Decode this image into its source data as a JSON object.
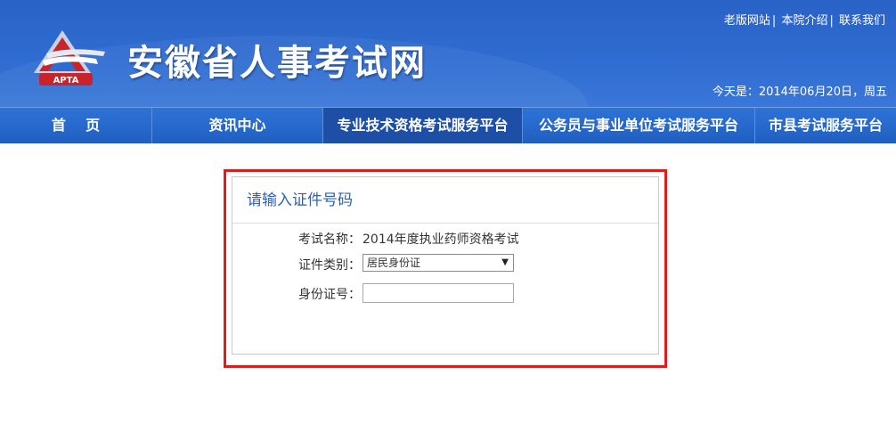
{
  "header": {
    "site_title": "安徽省人事考试网",
    "logo_text": "APTA",
    "top_links": [
      "老版网站",
      "本院介绍",
      "联系我们"
    ],
    "date_text": "今天是：2014年06月20日，周五"
  },
  "nav": {
    "items": [
      {
        "label": "首    页"
      },
      {
        "label": "资讯中心"
      },
      {
        "label": "专业技术资格考试服务平台"
      },
      {
        "label": "公务员与事业单位考试服务平台"
      },
      {
        "label": "市县考试服务平台"
      }
    ],
    "active_index": 2
  },
  "form": {
    "title": "请输入证件号码",
    "exam_name_label": "考试名称：",
    "exam_name_value": "2014年度执业药师资格考试",
    "id_type_label": "证件类别：",
    "id_type_value": "居民身份证",
    "id_number_label": "身份证号：",
    "id_number_value": "",
    "id_number_placeholder": ""
  },
  "colors": {
    "header_blue": "#2f6cd1",
    "nav_active": "#1d4fa6",
    "highlight_border": "#e01b1b",
    "title_blue": "#2f61b1"
  }
}
